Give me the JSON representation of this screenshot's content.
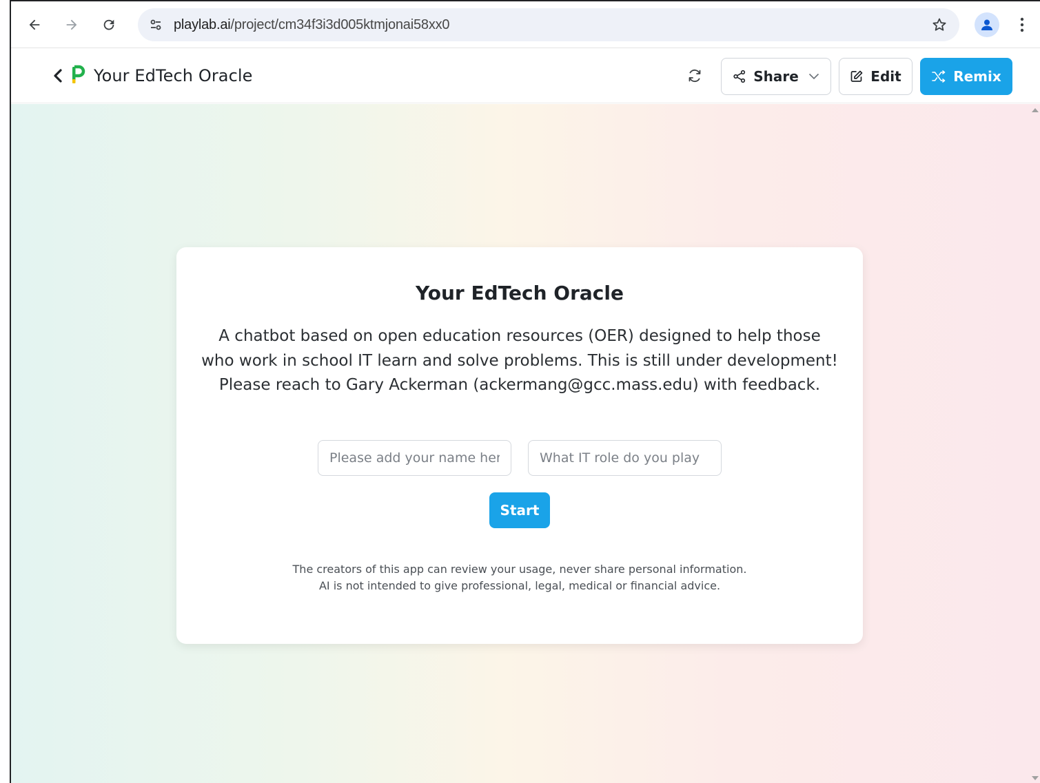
{
  "browser": {
    "url_host": "playlab.ai",
    "url_path": "/project/cm34f3i3d005ktmjonai58xx0"
  },
  "header": {
    "title": "Your EdTech Oracle",
    "share_label": "Share",
    "edit_label": "Edit",
    "remix_label": "Remix"
  },
  "card": {
    "title": "Your EdTech Oracle",
    "description": "A chatbot based on open education resources (OER) designed to help those who work in school IT learn and solve problems. This is still under development! Please reach to Gary Ackerman (ackermang@gcc.mass.edu) with feedback.",
    "name_placeholder": "Please add your name here",
    "role_placeholder": "What IT role do you play",
    "start_label": "Start",
    "disclaimer_line1": "The creators of this app can review your usage, never share personal information.",
    "disclaimer_line2": "AI is not intended to give professional, legal, medical or financial advice."
  },
  "colors": {
    "accent": "#1aa3e8",
    "logo_green": "#22b14c",
    "logo_yellow": "#f5c400"
  }
}
